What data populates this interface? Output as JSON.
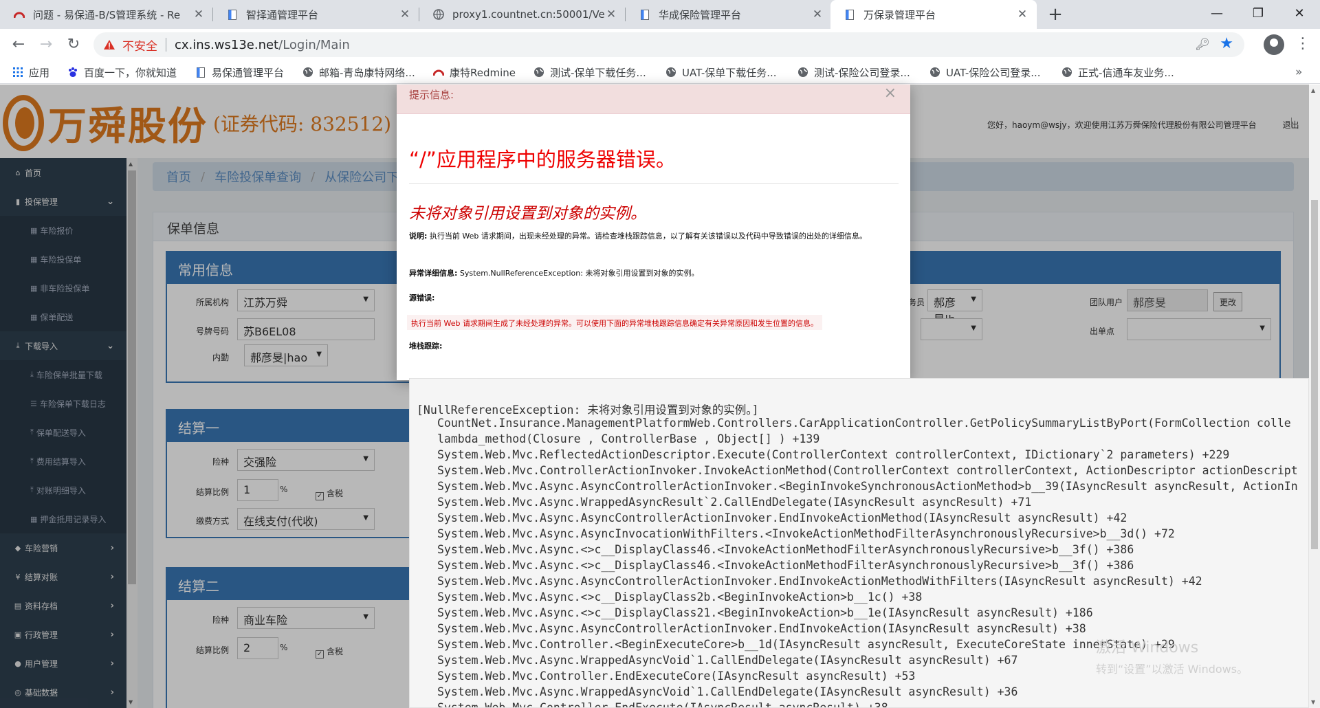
{
  "browser": {
    "tabs": [
      {
        "title": "问题 - 易保通-B/S管理系统 - Re"
      },
      {
        "title": "智择通管理平台"
      },
      {
        "title": "proxy1.countnet.cn:50001/Vel"
      },
      {
        "title": "华成保险管理平台"
      },
      {
        "title": "万保录管理平台"
      }
    ],
    "address": {
      "security_label": "不安全",
      "host": "cx.ins.ws13e.net",
      "path": "/Login/Main"
    },
    "bookmarks": [
      {
        "label": "应用"
      },
      {
        "label": "百度一下，你就知道"
      },
      {
        "label": "易保通管理平台"
      },
      {
        "label": "邮箱-青岛康特网络..."
      },
      {
        "label": "康特Redmine"
      },
      {
        "label": "测试-保单下载任务..."
      },
      {
        "label": "UAT-保单下载任务..."
      },
      {
        "label": "测试-保险公司登录..."
      },
      {
        "label": "UAT-保险公司登录..."
      },
      {
        "label": "正式-信通车友业务..."
      }
    ]
  },
  "site": {
    "logo_name": "万舜股份",
    "logo_code": "(证券代码: 832512)",
    "user_info": "您好，haoym@wsjy，欢迎使用江苏万舜保险代理股份有限公司管理平台",
    "logout": "退出"
  },
  "sidebar": {
    "items": [
      {
        "label": "首页",
        "icon": "home-icon"
      },
      {
        "label": "投保管理",
        "icon": "file-icon"
      },
      {
        "label": "车险报价",
        "icon": "grid-icon"
      },
      {
        "label": "车险投保单",
        "icon": "grid-icon"
      },
      {
        "label": "非车险投保单",
        "icon": "grid-icon"
      },
      {
        "label": "保单配送",
        "icon": "grid-icon"
      },
      {
        "label": "下载导入",
        "icon": "download-icon"
      },
      {
        "label": "车险保单批量下载",
        "icon": "download-icon"
      },
      {
        "label": "车险保单下载日志",
        "icon": "list-icon"
      },
      {
        "label": "保单配送导入",
        "icon": "upload-icon"
      },
      {
        "label": "费用结算导入",
        "icon": "upload-icon"
      },
      {
        "label": "对账明细导入",
        "icon": "upload-icon"
      },
      {
        "label": "押金抵用记录导入",
        "icon": "grid-icon"
      },
      {
        "label": "车险营销",
        "icon": "car-icon"
      },
      {
        "label": "结算对账",
        "icon": "yen-icon"
      },
      {
        "label": "资料存档",
        "icon": "archive-icon"
      },
      {
        "label": "行政管理",
        "icon": "inbox-icon"
      },
      {
        "label": "用户管理",
        "icon": "user-icon"
      },
      {
        "label": "基础数据",
        "icon": "data-icon"
      }
    ]
  },
  "content": {
    "breadcrumb": [
      "首页",
      "车险投保单查询",
      "从保险公司下载"
    ],
    "panel_title": "保单信息",
    "section1": {
      "title": "常用信息",
      "org_label": "所属机构",
      "org_value": "江苏万舜",
      "plate_label": "号牌号码",
      "plate_value": "苏B6EL08",
      "inner_label": "内勤",
      "inner_value": "郝彦旻|hao",
      "clerk_label": "务员",
      "clerk_value": "郝彦旻|h",
      "team_label": "团队用户",
      "team_value": "郝彦旻",
      "change_btn": "更改",
      "outlet_label": "出单点"
    },
    "section2": {
      "title": "结算一",
      "type_label": "险种",
      "type_value": "交强险",
      "ratio_label": "结算比例",
      "ratio_value": "1",
      "percent": "%",
      "tax_label": "含税",
      "pay_label": "缴费方式",
      "pay_value": "在线支付(代收)"
    },
    "section3": {
      "title": "结算二",
      "type_label": "险种",
      "type_value": "商业车险",
      "ratio_label": "结算比例",
      "ratio_value": "2",
      "percent": "%",
      "tax_label": "含税"
    }
  },
  "modal": {
    "header": "提示信息:",
    "error_title": "“/”应用程序中的服务器错误。",
    "error_subtitle": "未将对象引用设置到对象的实例。",
    "desc_label": "说明:",
    "desc_text": "执行当前 Web 请求期间，出现未经处理的异常。请检查堆栈跟踪信息，以了解有关该错误以及代码中导致错误的出处的详细信息。",
    "detail_label": "异常详细信息:",
    "detail_text": "System.NullReferenceException: 未将对象引用设置到对象的实例。",
    "source_label": "源错误:",
    "source_text": "执行当前 Web 请求期间生成了未经处理的异常。可以使用下面的异常堆栈跟踪信息确定有关异常原因和发生位置的信息。",
    "stack_label": "堆栈跟踪:"
  },
  "stack": {
    "exception": "[NullReferenceException: 未将对象引用设置到对象的实例。]",
    "lines": [
      "CountNet.Insurance.ManagementPlatformWeb.Controllers.CarApplicationController.GetPolicySummaryListByPort(FormCollection colle",
      "lambda_method(Closure , ControllerBase , Object[] ) +139",
      "System.Web.Mvc.ReflectedActionDescriptor.Execute(ControllerContext controllerContext, IDictionary`2 parameters) +229",
      "System.Web.Mvc.ControllerActionInvoker.InvokeActionMethod(ControllerContext controllerContext, ActionDescriptor actionDescript",
      "System.Web.Mvc.Async.AsyncControllerActionInvoker.<BeginInvokeSynchronousActionMethod>b__39(IAsyncResult asyncResult, ActionIn",
      "System.Web.Mvc.Async.WrappedAsyncResult`2.CallEndDelegate(IAsyncResult asyncResult) +71",
      "System.Web.Mvc.Async.AsyncControllerActionInvoker.EndInvokeActionMethod(IAsyncResult asyncResult) +42",
      "System.Web.Mvc.Async.AsyncInvocationWithFilters.<InvokeActionMethodFilterAsynchronouslyRecursive>b__3d() +72",
      "System.Web.Mvc.Async.<>c__DisplayClass46.<InvokeActionMethodFilterAsynchronouslyRecursive>b__3f() +386",
      "System.Web.Mvc.Async.<>c__DisplayClass46.<InvokeActionMethodFilterAsynchronouslyRecursive>b__3f() +386",
      "System.Web.Mvc.Async.AsyncControllerActionInvoker.EndInvokeActionMethodWithFilters(IAsyncResult asyncResult) +42",
      "System.Web.Mvc.Async.<>c__DisplayClass2b.<BeginInvokeAction>b__1c() +38",
      "System.Web.Mvc.Async.<>c__DisplayClass21.<BeginInvokeAction>b__1e(IAsyncResult asyncResult) +186",
      "System.Web.Mvc.Async.AsyncControllerActionInvoker.EndInvokeAction(IAsyncResult asyncResult) +38",
      "System.Web.Mvc.Controller.<BeginExecuteCore>b__1d(IAsyncResult asyncResult, ExecuteCoreState innerState) +29",
      "System.Web.Mvc.Async.WrappedAsyncVoid`1.CallEndDelegate(IAsyncResult asyncResult) +67",
      "System.Web.Mvc.Controller.EndExecuteCore(IAsyncResult asyncResult) +53",
      "System.Web.Mvc.Async.WrappedAsyncVoid`1.CallEndDelegate(IAsyncResult asyncResult) +36",
      "System.Web.Mvc.Controller.EndExecute(IAsyncResult asyncResult) +38"
    ]
  },
  "watermark": {
    "line1": "激活 Windows",
    "line2": "转到“设置”以激活 Windows。"
  },
  "colors": {
    "error_red": "#e00000",
    "modal_header_bg": "#f2dede",
    "section_blue": "#3a78b6",
    "sidebar_bg": "#2f4050",
    "logo_orange": "#e07a1f"
  }
}
